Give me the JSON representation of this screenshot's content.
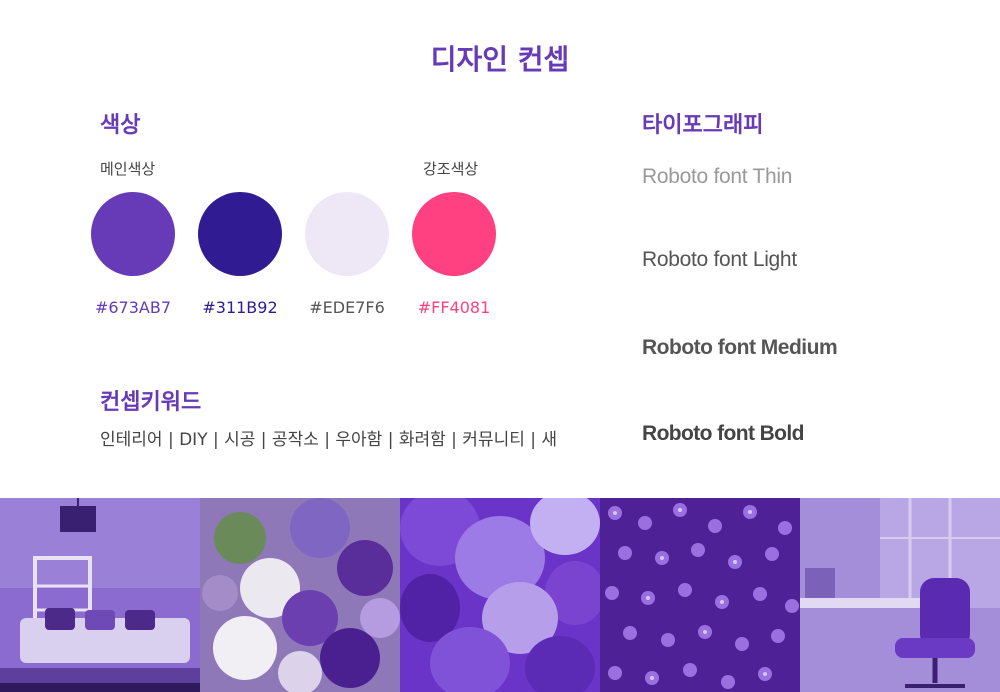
{
  "page": {
    "title": "디자인 컨셉"
  },
  "colors": {
    "heading": "#673AB7",
    "text": "#444444"
  },
  "color_section": {
    "heading": "색상",
    "main_label": "메인색상",
    "accent_label": "강조색상",
    "swatches": [
      {
        "hex": "#673AB7",
        "label": "#673AB7"
      },
      {
        "hex": "#311B92",
        "label": "#311B92"
      },
      {
        "hex": "#EDE7F6",
        "label": "#EDE7F6"
      },
      {
        "hex": "#FF4081",
        "label": "#FF4081"
      }
    ]
  },
  "keyword_section": {
    "heading": "컨셉키워드",
    "keywords": "인테리어 | DIY | 시공 | 공작소 | 우아함 | 화려함 | 커뮤니티 | 새"
  },
  "typography_section": {
    "heading": "타이포그래피",
    "samples": [
      {
        "label": "Roboto font Thin",
        "weight": "thin"
      },
      {
        "label": "Roboto font Light",
        "weight": "light"
      },
      {
        "label": "Roboto font Medium",
        "weight": "medium"
      },
      {
        "label": "Roboto font Bold",
        "weight": "bold"
      }
    ]
  },
  "photos": [
    {
      "name": "living-room-photo",
      "tint": "#7B55C9"
    },
    {
      "name": "flower-bouquet-photo",
      "tint": "#6F45B8"
    },
    {
      "name": "balloons-photo",
      "tint": "#6A34C8"
    },
    {
      "name": "phlox-flowers-photo",
      "tint": "#5E2AA6"
    },
    {
      "name": "office-chair-photo",
      "tint": "#8A6ACF"
    }
  ]
}
